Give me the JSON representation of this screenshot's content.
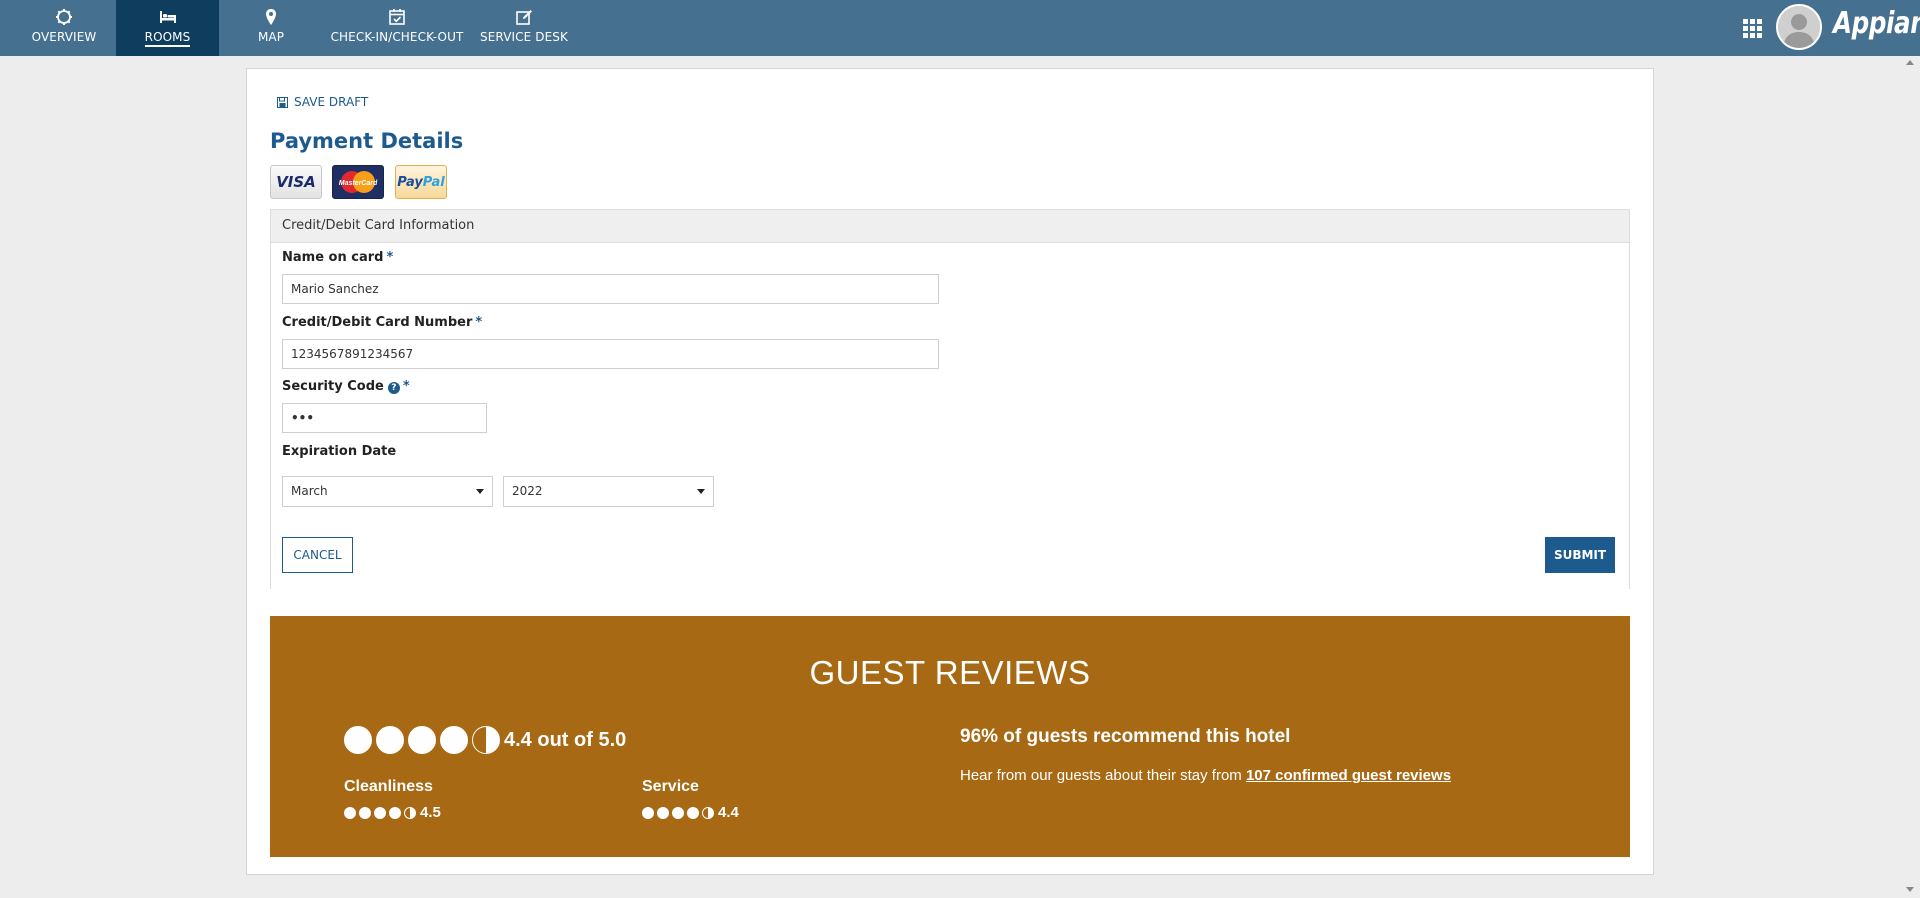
{
  "nav": {
    "tabs": [
      {
        "label": "OVERVIEW",
        "icon": "gear-icon"
      },
      {
        "label": "ROOMS",
        "icon": "bed-icon",
        "active": true
      },
      {
        "label": "MAP",
        "icon": "map-pin-icon"
      },
      {
        "label": "CHECK-IN/CHECK-OUT",
        "icon": "calendar-check-icon"
      },
      {
        "label": "SERVICE DESK",
        "icon": "edit-icon"
      }
    ],
    "brand": "Appian",
    "bar_color": "#45708f",
    "active_color": "#0f3d5e"
  },
  "form": {
    "save_draft": "SAVE DRAFT",
    "title": "Payment Details",
    "payment_logos": {
      "visa": "VISA",
      "mastercard": "MasterCard",
      "paypal_pay": "Pay",
      "paypal_pal": "Pal"
    },
    "section_title": "Credit/Debit Card Information",
    "name_label": "Name on card",
    "name_value": "Mario Sanchez",
    "card_label": "Credit/Debit Card Number",
    "card_value": "1234567891234567",
    "security_label": "Security Code",
    "security_value": "•••",
    "required_mark": "*",
    "help_mark": "?",
    "expiration_label": "Expiration Date",
    "exp_month": "March",
    "exp_year": "2022",
    "cancel": "CANCEL",
    "submit": "SUBMIT",
    "accent_color": "#1d5a8e"
  },
  "reviews": {
    "title": "GUEST REVIEWS",
    "overall_text": "4.4 out of 5.0",
    "overall_circles": {
      "full": 4,
      "half": 1
    },
    "cleanliness_label": "Cleanliness",
    "cleanliness_value": "4.5",
    "cleanliness_circles": {
      "full": 4,
      "half": 1
    },
    "service_label": "Service",
    "service_value": "4.4",
    "service_circles": {
      "full": 4,
      "half": 1
    },
    "recommend": "96% of guests recommend this hotel",
    "hear_text": "Hear from our guests about their stay from ",
    "link_text": "107 confirmed guest reviews",
    "bg_color": "#a76913"
  }
}
